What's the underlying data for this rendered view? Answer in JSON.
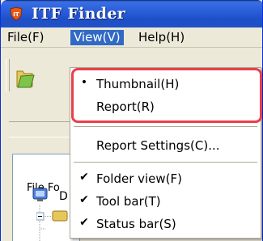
{
  "window": {
    "title": "ITF Finder"
  },
  "menubar": {
    "items": [
      {
        "label": "File(F)"
      },
      {
        "label": "View(V)"
      },
      {
        "label": "Help(H)"
      }
    ]
  },
  "view_menu": {
    "items": [
      {
        "label": "Thumbnail(H)",
        "mark": "•"
      },
      {
        "label": "Report(R)",
        "mark": ""
      },
      {
        "label": "Report Settings(C)...",
        "mark": ""
      },
      {
        "label": "Folder view(F)",
        "mark": "✔"
      },
      {
        "label": "Tool bar(T)",
        "mark": "✔"
      },
      {
        "label": "Status bar(S)",
        "mark": "✔"
      }
    ]
  },
  "left_panel": {
    "tab_label": "File Fo",
    "tree_root_label": "D"
  },
  "colors": {
    "titlebar": "#2a5fd9",
    "menu_active": "#316ac5",
    "highlight": "#e8404a"
  }
}
